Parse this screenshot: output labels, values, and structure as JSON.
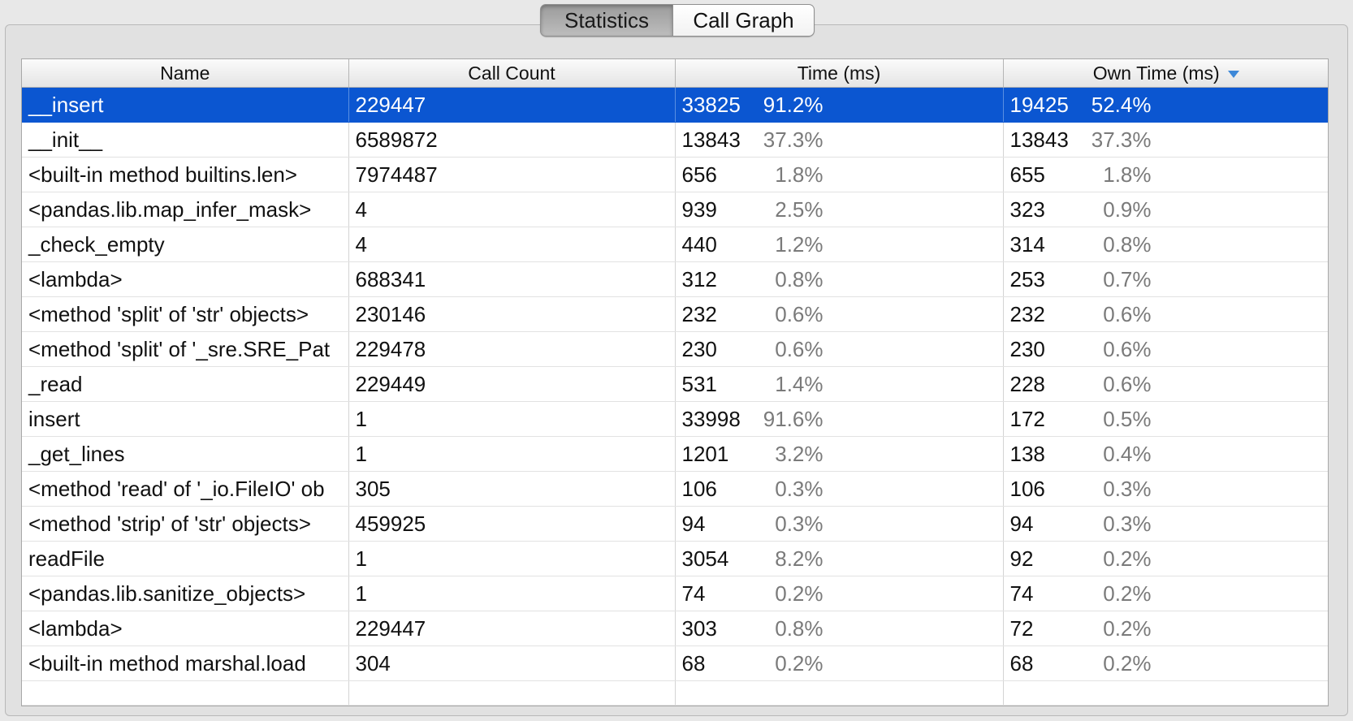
{
  "tabs": {
    "statistics": "Statistics",
    "call_graph": "Call Graph"
  },
  "columns": {
    "name": "Name",
    "call_count": "Call Count",
    "time": "Time (ms)",
    "own_time": "Own Time (ms)"
  },
  "rows": [
    {
      "name": "__insert",
      "call_count": "229447",
      "time": "33825",
      "time_pct": "91.2%",
      "own": "19425",
      "own_pct": "52.4%"
    },
    {
      "name": "__init__",
      "call_count": "6589872",
      "time": "13843",
      "time_pct": "37.3%",
      "own": "13843",
      "own_pct": "37.3%"
    },
    {
      "name": "<built-in method builtins.len>",
      "call_count": "7974487",
      "time": "656",
      "time_pct": "1.8%",
      "own": "655",
      "own_pct": "1.8%"
    },
    {
      "name": "<pandas.lib.map_infer_mask>",
      "call_count": "4",
      "time": "939",
      "time_pct": "2.5%",
      "own": "323",
      "own_pct": "0.9%"
    },
    {
      "name": "_check_empty",
      "call_count": "4",
      "time": "440",
      "time_pct": "1.2%",
      "own": "314",
      "own_pct": "0.8%"
    },
    {
      "name": "<lambda>",
      "call_count": "688341",
      "time": "312",
      "time_pct": "0.8%",
      "own": "253",
      "own_pct": "0.7%"
    },
    {
      "name": "<method 'split' of 'str' objects>",
      "call_count": "230146",
      "time": "232",
      "time_pct": "0.6%",
      "own": "232",
      "own_pct": "0.6%"
    },
    {
      "name": "<method 'split' of '_sre.SRE_Pat",
      "call_count": "229478",
      "time": "230",
      "time_pct": "0.6%",
      "own": "230",
      "own_pct": "0.6%"
    },
    {
      "name": "_read",
      "call_count": "229449",
      "time": "531",
      "time_pct": "1.4%",
      "own": "228",
      "own_pct": "0.6%"
    },
    {
      "name": "insert",
      "call_count": "1",
      "time": "33998",
      "time_pct": "91.6%",
      "own": "172",
      "own_pct": "0.5%"
    },
    {
      "name": "_get_lines",
      "call_count": "1",
      "time": "1201",
      "time_pct": "3.2%",
      "own": "138",
      "own_pct": "0.4%"
    },
    {
      "name": "<method 'read' of '_io.FileIO' ob",
      "call_count": "305",
      "time": "106",
      "time_pct": "0.3%",
      "own": "106",
      "own_pct": "0.3%"
    },
    {
      "name": "<method 'strip' of 'str' objects>",
      "call_count": "459925",
      "time": "94",
      "time_pct": "0.3%",
      "own": "94",
      "own_pct": "0.3%"
    },
    {
      "name": "readFile",
      "call_count": "1",
      "time": "3054",
      "time_pct": "8.2%",
      "own": "92",
      "own_pct": "0.2%"
    },
    {
      "name": "<pandas.lib.sanitize_objects>",
      "call_count": "1",
      "time": "74",
      "time_pct": "0.2%",
      "own": "74",
      "own_pct": "0.2%"
    },
    {
      "name": "<lambda>",
      "call_count": "229447",
      "time": "303",
      "time_pct": "0.8%",
      "own": "72",
      "own_pct": "0.2%"
    },
    {
      "name": "<built-in method marshal.load",
      "call_count": "304",
      "time": "68",
      "time_pct": "0.2%",
      "own": "68",
      "own_pct": "0.2%"
    }
  ],
  "selected_row": 0,
  "sorted_column": "own_time",
  "sort_direction": "descending",
  "colors": {
    "selection": "#0b56d1",
    "sort_arrow": "#3d88d8"
  }
}
